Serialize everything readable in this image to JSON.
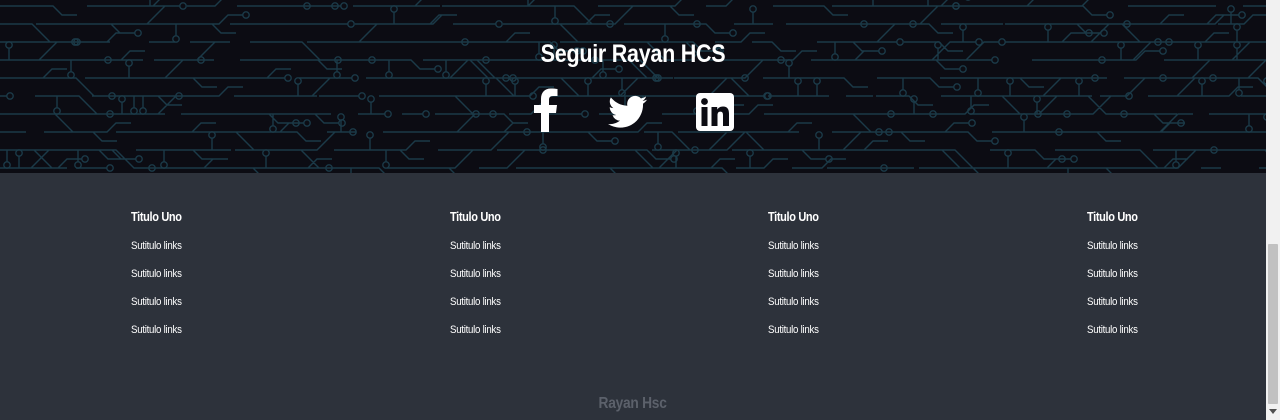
{
  "hero": {
    "title": "Seguir Rayan HCS",
    "social": [
      {
        "name": "facebook",
        "icon": "facebook-icon"
      },
      {
        "name": "twitter",
        "icon": "twitter-icon"
      },
      {
        "name": "linkedin",
        "icon": "linkedin-icon"
      }
    ],
    "background_color": "#0c0c13",
    "circuit_color": "#1b3a48"
  },
  "footer": {
    "columns": [
      {
        "title": "Titulo Uno",
        "links": [
          "Sutitulo links",
          "Sutitulo links",
          "Sutitulo links",
          "Sutitulo links"
        ]
      },
      {
        "title": "Titulo Uno",
        "links": [
          "Sutitulo links",
          "Sutitulo links",
          "Sutitulo links",
          "Sutitulo links"
        ]
      },
      {
        "title": "Titulo Uno",
        "links": [
          "Sutitulo links",
          "Sutitulo links",
          "Sutitulo links",
          "Sutitulo links"
        ]
      },
      {
        "title": "Titulo Uno",
        "links": [
          "Sutitulo links",
          "Sutitulo links",
          "Sutitulo links",
          "Sutitulo links"
        ]
      }
    ],
    "copyright": "Rayan Hsc",
    "background_color": "#2d323b"
  }
}
